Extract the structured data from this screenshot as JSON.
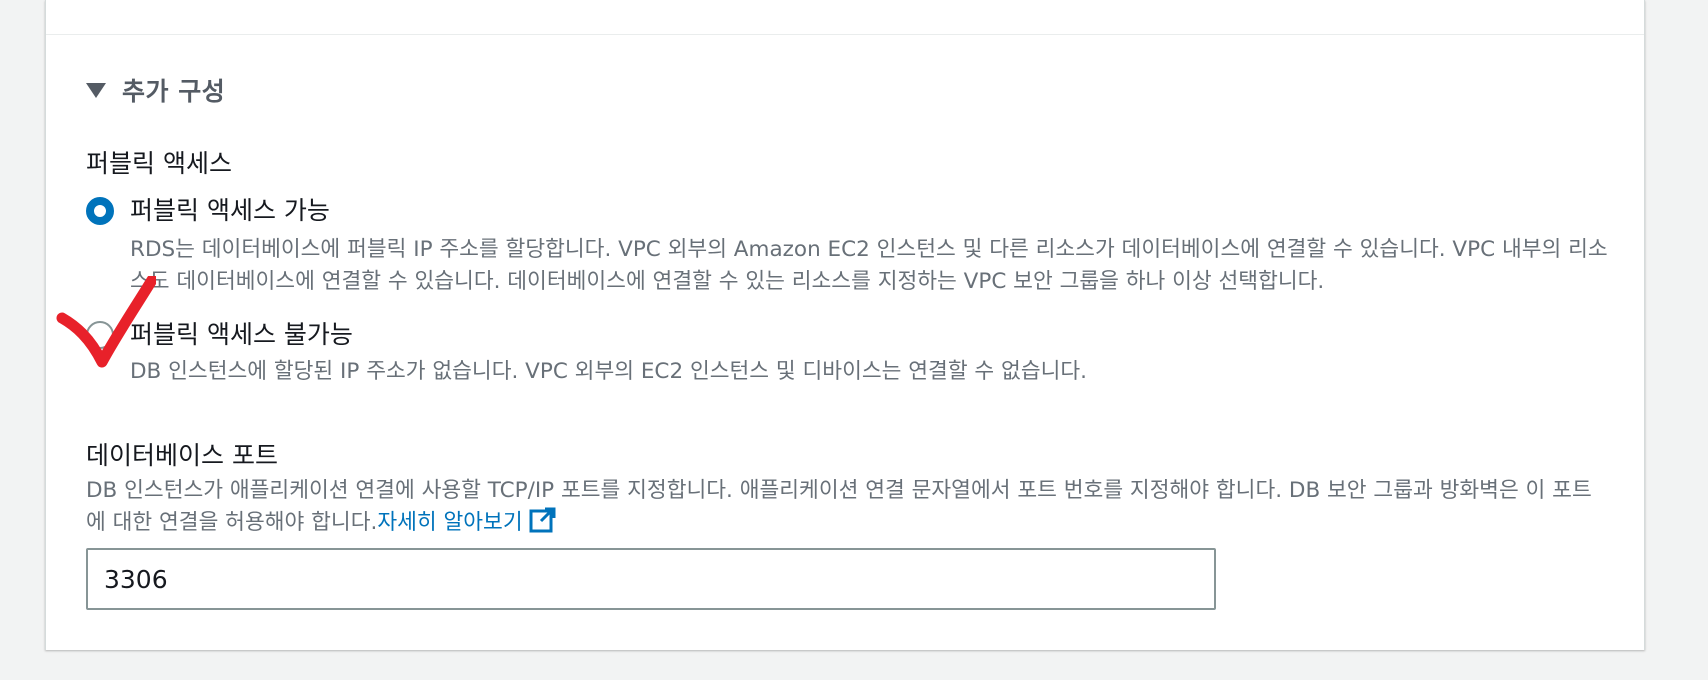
{
  "section": {
    "title": "추가 구성",
    "expanded": true
  },
  "public_access": {
    "label": "퍼블릭 액세스",
    "options": [
      {
        "label": "퍼블릭 액세스 가능",
        "description": "RDS는 데이터베이스에 퍼블릭 IP 주소를 할당합니다. VPC 외부의 Amazon EC2 인스턴스 및 다른 리소스가 데이터베이스에 연결할 수 있습니다. VPC 내부의 리소스도 데이터베이스에 연결할 수 있습니다. 데이터베이스에 연결할 수 있는 리소스를 지정하는 VPC 보안 그룹을 하나 이상 선택합니다.",
        "selected": true
      },
      {
        "label": "퍼블릭 액세스 불가능",
        "description": "DB 인스턴스에 할당된 IP 주소가 없습니다. VPC 외부의 EC2 인스턴스 및 디바이스는 연결할 수 없습니다.",
        "selected": false
      }
    ]
  },
  "database_port": {
    "label": "데이터베이스 포트",
    "description": "DB 인스턴스가 애플리케이션 연결에 사용할 TCP/IP 포트를 지정합니다. 애플리케이션 연결 문자열에서 포트 번호를 지정해야 합니다. DB 보안 그룹과 방화벽은 이 포트에 대한 연결을 허용해야 합니다.",
    "learn_more": "자세히 알아보기",
    "value": "3306"
  },
  "icons": {
    "caret": "caret-down-icon",
    "external_link": "external-link-icon",
    "annotation": "red-checkmark-icon"
  },
  "colors": {
    "accent": "#0073bb",
    "annotation": "#e8212a",
    "muted_text": "#687078",
    "heading_text": "#545b64"
  }
}
